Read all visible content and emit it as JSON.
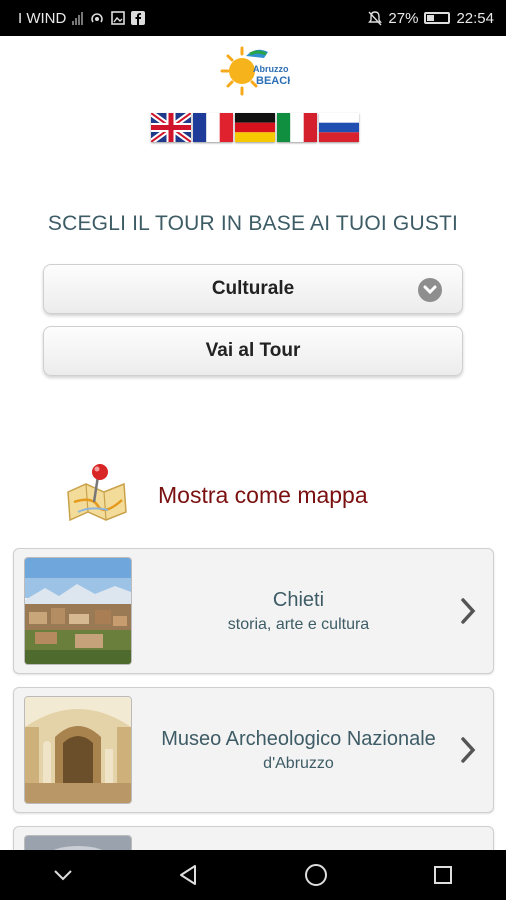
{
  "status_bar": {
    "carrier": "I WIND",
    "battery": "27%",
    "time": "22:54"
  },
  "header": {
    "logo_text": "Abruzzo BEACH",
    "flags": [
      "uk-flag",
      "france-flag",
      "germany-flag",
      "italy-flag",
      "russia-flag"
    ]
  },
  "main": {
    "heading": "SCEGLI IL TOUR IN BASE AI TUOI GUSTI",
    "tour_select": "Culturale",
    "go_button": "Vai al Tour",
    "map_link": "Mostra come mappa"
  },
  "cards": [
    {
      "title": "Chieti",
      "subtitle": "storia, arte e cultura"
    },
    {
      "title": "Museo Archeologico Nazionale",
      "subtitle": "d'Abruzzo"
    }
  ],
  "colors": {
    "heading": "#3e5c66",
    "map_label": "#7a1010",
    "chevron": "#8e8e8e"
  }
}
